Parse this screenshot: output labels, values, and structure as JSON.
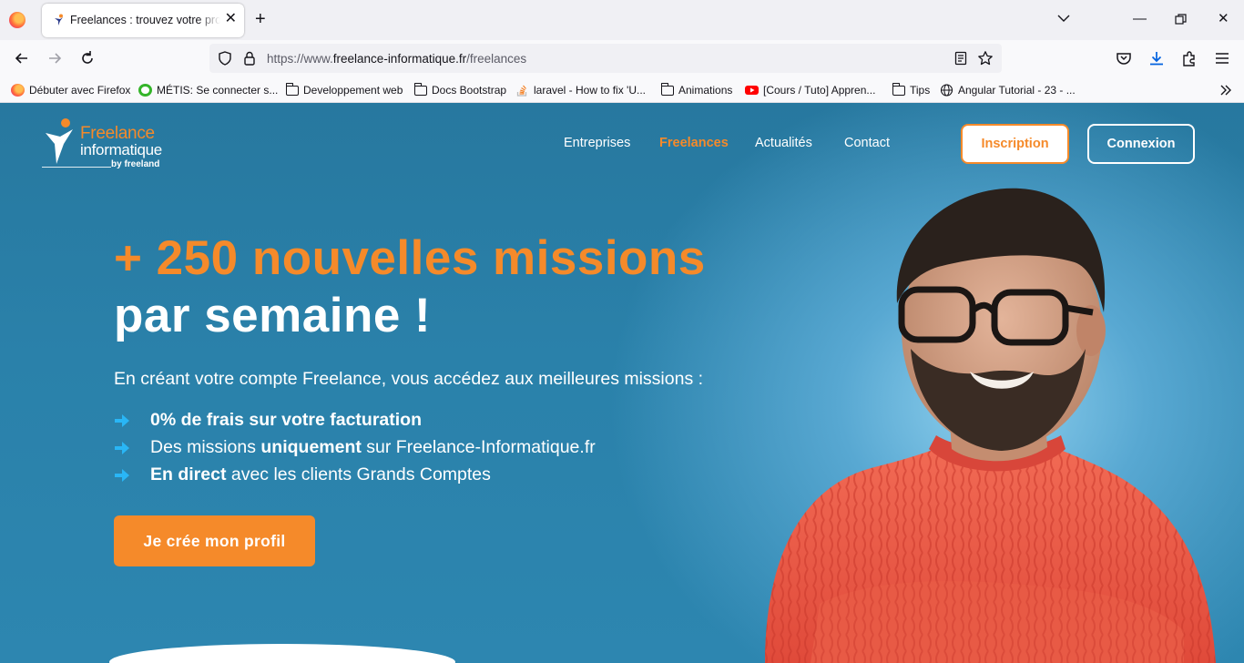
{
  "browser": {
    "tab_title": "Freelances : trouvez votre proch",
    "url_prefix": "https://www.",
    "url_domain": "freelance-informatique.fr",
    "url_path": "/freelances",
    "bookmarks": [
      {
        "label": "Débuter avec Firefox",
        "icon": "firefox-icon"
      },
      {
        "label": "MÉTIS: Se connecter s...",
        "icon": "metis-icon"
      },
      {
        "label": "Developpement web",
        "icon": "folder-icon"
      },
      {
        "label": "Docs Bootstrap",
        "icon": "folder-icon"
      },
      {
        "label": "laravel - How to fix 'U...",
        "icon": "stackoverflow-icon"
      },
      {
        "label": "Animations",
        "icon": "folder-icon"
      },
      {
        "label": "[Cours / Tuto] Appren...",
        "icon": "youtube-icon"
      },
      {
        "label": "Tips",
        "icon": "folder-icon"
      },
      {
        "label": "Angular Tutorial - 23 - ...",
        "icon": "globe-icon"
      }
    ]
  },
  "site": {
    "logo_line1": "Freelance",
    "logo_line2": "informatique",
    "logo_by": "by freeland",
    "nav": [
      "Entreprises",
      "Freelances",
      "Actualités",
      "Contact"
    ],
    "active_nav": "Freelances",
    "signup_label": "Inscription",
    "login_label": "Connexion"
  },
  "hero": {
    "title_line1": "+ 250 nouvelles missions",
    "title_line2": "par semaine !",
    "intro": "En créant votre compte Freelance, vous accédez aux meilleures missions :",
    "feature1_bold": "0% de frais sur votre facturation",
    "feature2_pre": "Des missions ",
    "feature2_bold": "uniquement",
    "feature2_post": " sur Freelance-Informatique.fr",
    "feature3_bold": "En direct",
    "feature3_post": " avec les clients Grands Comptes",
    "cta_label": "Je crée mon profil"
  },
  "colors": {
    "brand_orange": "#f58a2a",
    "hero_blue": "#2a81aa",
    "arrow_blue": "#29b6f6"
  }
}
